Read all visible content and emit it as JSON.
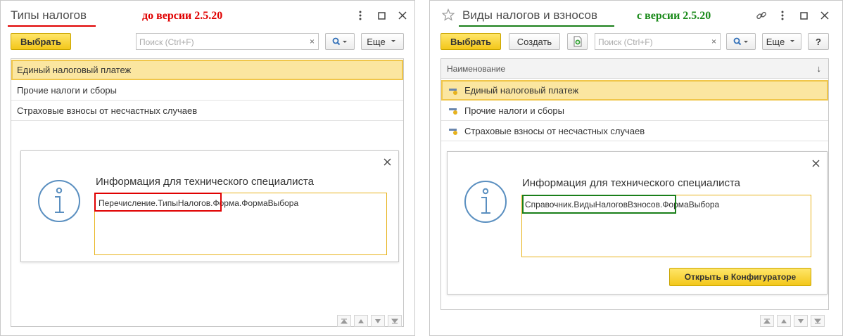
{
  "left": {
    "title": "Типы налогов",
    "version_label": "до версии 2.5.20",
    "select_button": "Выбрать",
    "search_placeholder": "Поиск (Ctrl+F)",
    "more_button": "Еще",
    "rows": [
      "Единый налоговый платеж",
      "Прочие налоги и сборы",
      "Страховые взносы от несчастных случаев"
    ],
    "info": {
      "title": "Информация для технического специалиста",
      "path_highlighted": "Перечисление.ТипыНалогов.",
      "path_rest": "Форма.ФормаВыбора"
    }
  },
  "right": {
    "title": "Виды налогов и взносов",
    "version_label": "с версии 2.5.20",
    "select_button": "Выбрать",
    "create_button": "Создать",
    "search_placeholder": "Поиск (Ctrl+F)",
    "more_button": "Еще",
    "help_button": "?",
    "column_header": "Наименование",
    "sort_indicator": "↓",
    "rows": [
      "Единый налоговый платеж",
      "Прочие налоги и сборы",
      "Страховые взносы от несчастных случаев"
    ],
    "info": {
      "title": "Информация для технического специалиста",
      "path_highlighted": "Справочник.ВидыНалоговВзносов.",
      "path_rest": "ФормаВыбора",
      "open_button": "Открыть в Конфигураторе"
    }
  },
  "colors": {
    "left_underline": "#e00000",
    "left_version": "#e00000",
    "right_underline": "#1a7f1a",
    "right_version": "#1a8a1a",
    "left_highlight": "#e00000",
    "right_highlight": "#1a7f1a"
  },
  "icons": [
    "more-vertical-icon",
    "maximize-icon",
    "close-icon",
    "star-icon",
    "link-icon",
    "search-icon",
    "chevron-down-icon",
    "add-copy-icon",
    "info-circle-icon",
    "row-item-icon",
    "nav-first-icon",
    "nav-up-icon",
    "nav-down-icon",
    "nav-last-icon"
  ]
}
